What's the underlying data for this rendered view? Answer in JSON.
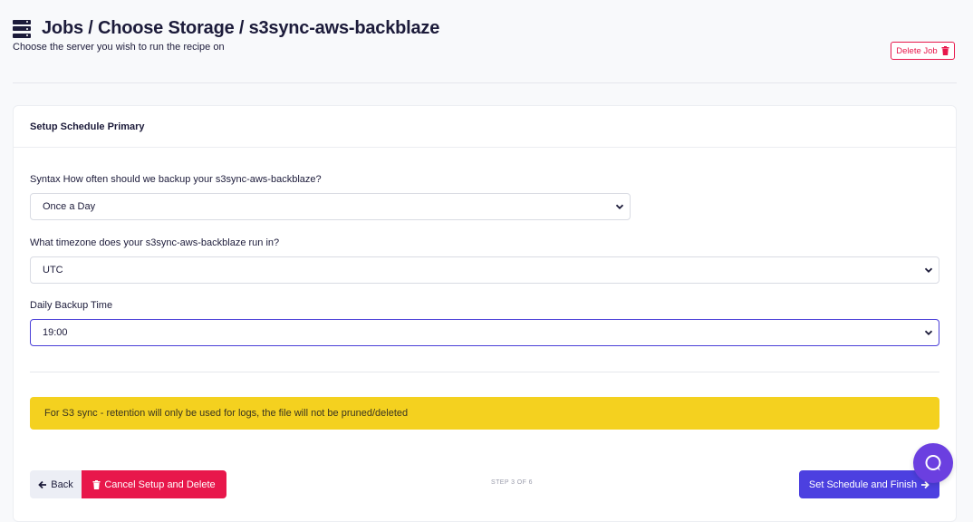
{
  "header": {
    "title": "Jobs / Choose Storage / s3sync-aws-backblaze",
    "subtitle": "Choose the server you wish to run the recipe on",
    "delete_job_label": "Delete Job"
  },
  "card": {
    "title": "Setup Schedule Primary",
    "fields": {
      "frequency": {
        "label": "Syntax How often should we backup your s3sync-aws-backblaze?",
        "value": "Once a Day"
      },
      "timezone": {
        "label": "What timezone does your s3sync-aws-backblaze run in?",
        "value": "UTC"
      },
      "time": {
        "label": "Daily Backup Time",
        "value": "19:00"
      }
    },
    "alert": "For S3 sync - retention will only be used for logs, the file will not be pruned/deleted",
    "footer": {
      "back_label": "Back",
      "cancel_label": "Cancel Setup and Delete",
      "step_text": "STEP 3 OF 6",
      "finish_label": "Set Schedule and Finish"
    }
  },
  "icons": {
    "server": "server-icon",
    "trash": "trash-icon",
    "arrow_left": "arrow-left-icon",
    "arrow_right": "arrow-right-icon",
    "chevron": "chevron-down-icon",
    "chat": "chat-icon"
  },
  "colors": {
    "primary": "#4c40e0",
    "danger": "#e8174b",
    "warning": "#f4d11f",
    "text": "#1c1b3a",
    "chat": "#6b3fe0"
  }
}
